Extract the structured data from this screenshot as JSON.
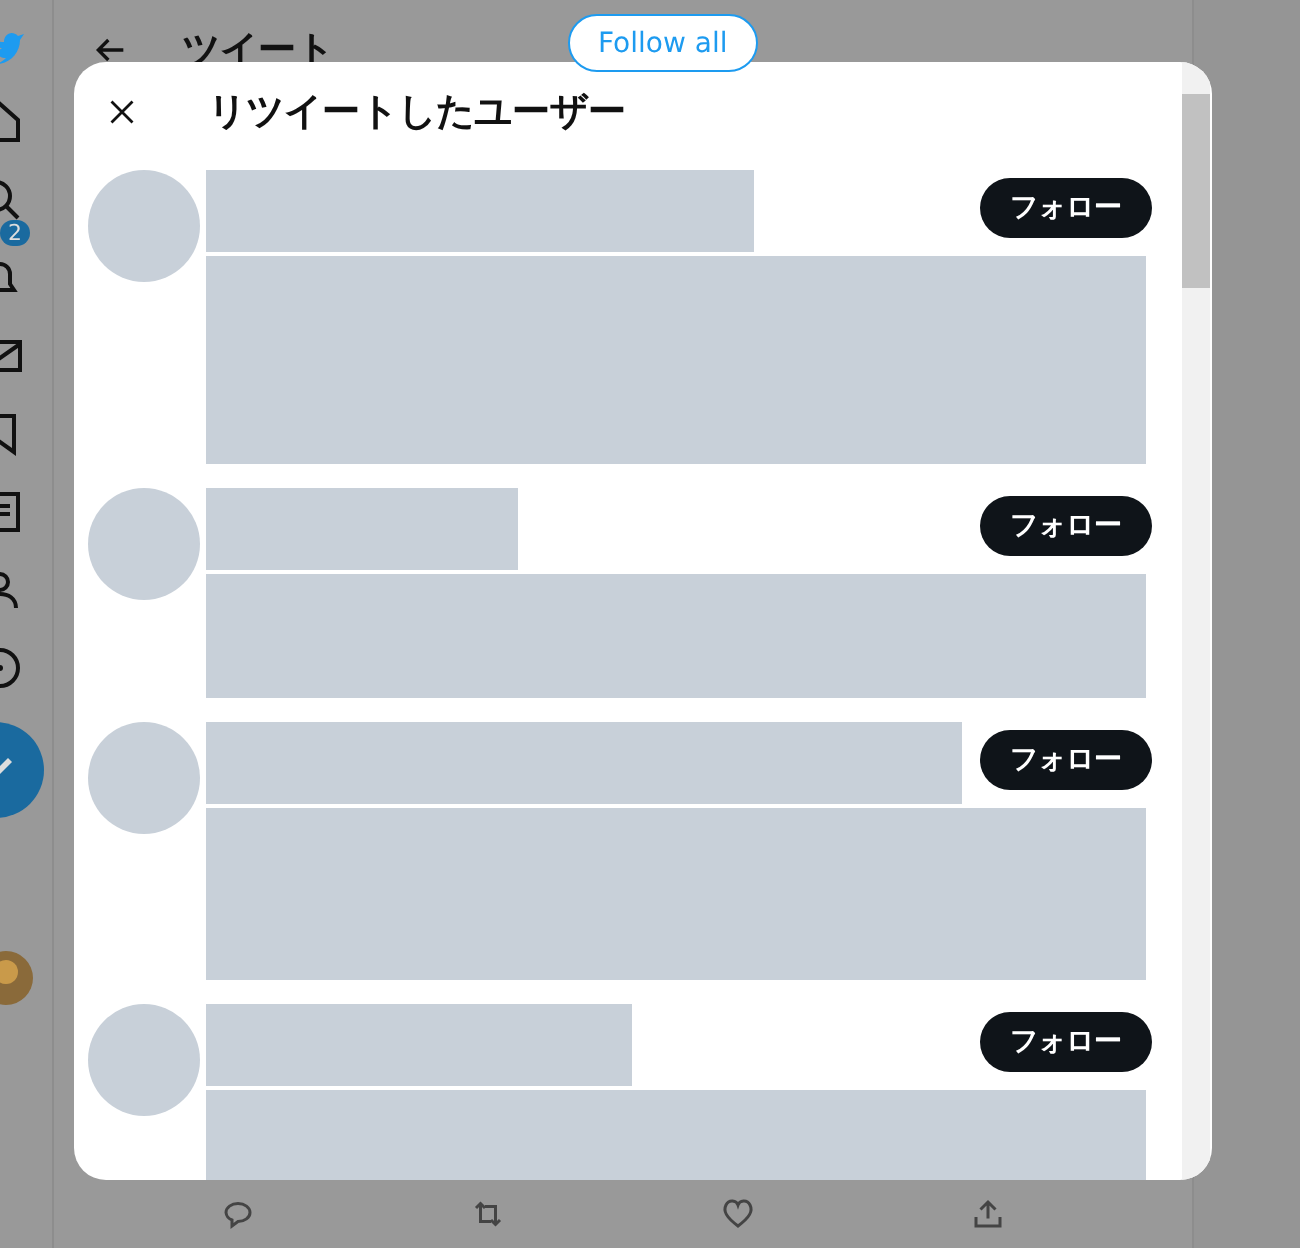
{
  "background": {
    "title": "ツイート",
    "badge": "2"
  },
  "extension": {
    "button": "Follow all"
  },
  "dialog": {
    "title": "リツイートしたユーザー",
    "users": [
      {
        "follow_label": "フォロー"
      },
      {
        "follow_label": "フォロー"
      },
      {
        "follow_label": "フォロー"
      },
      {
        "follow_label": "フォロー"
      }
    ]
  }
}
